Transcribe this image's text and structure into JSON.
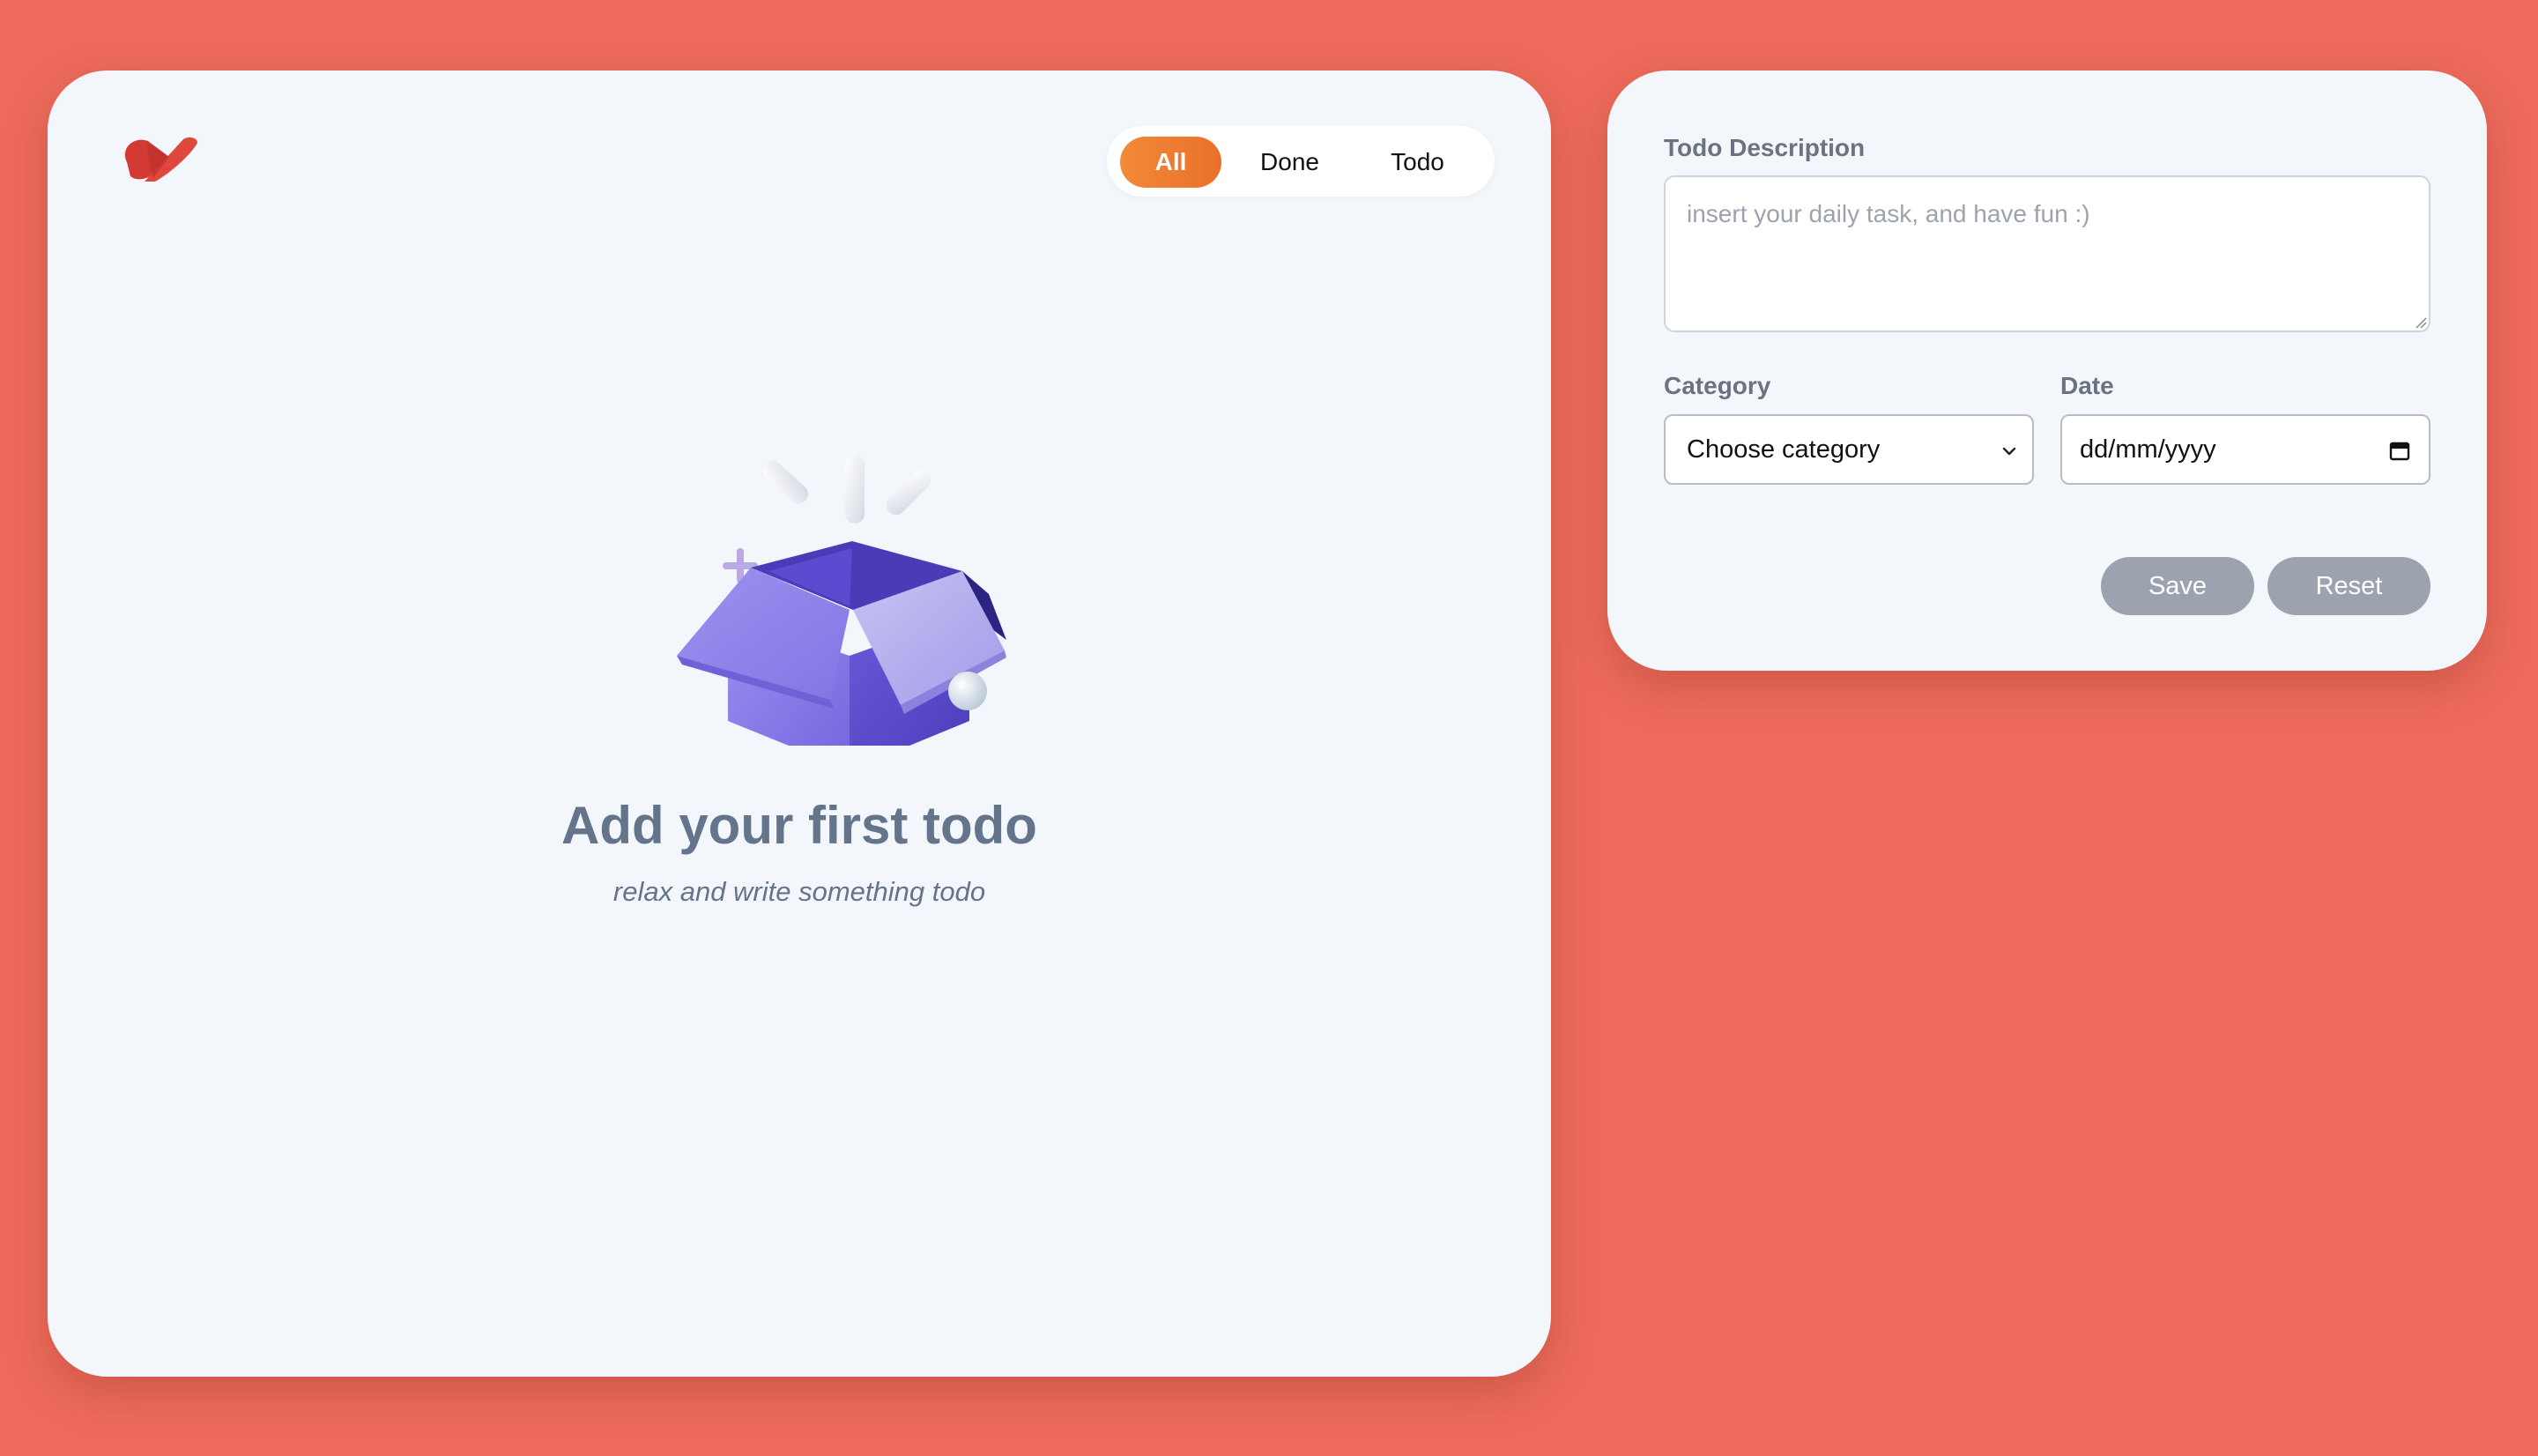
{
  "filter_tabs": {
    "items": [
      {
        "label": "All",
        "active": true
      },
      {
        "label": "Done",
        "active": false
      },
      {
        "label": "Todo",
        "active": false
      }
    ]
  },
  "empty_state": {
    "title": "Add your first todo",
    "subtitle": "relax and write something todo",
    "illustration": "open-box"
  },
  "form": {
    "description": {
      "label": "Todo Description",
      "placeholder": "insert your daily task, and have fun :)",
      "value": ""
    },
    "category": {
      "label": "Category",
      "selected": "Choose category"
    },
    "date": {
      "label": "Date",
      "value": "dd/mm/yyyy"
    },
    "save_label": "Save",
    "reset_label": "Reset"
  },
  "colors": {
    "background": "#ee6b5b",
    "panel": "#f3f6fb",
    "accent": "#ef7f33",
    "muted_button": "#9ca3af",
    "text_muted": "#64748b"
  }
}
